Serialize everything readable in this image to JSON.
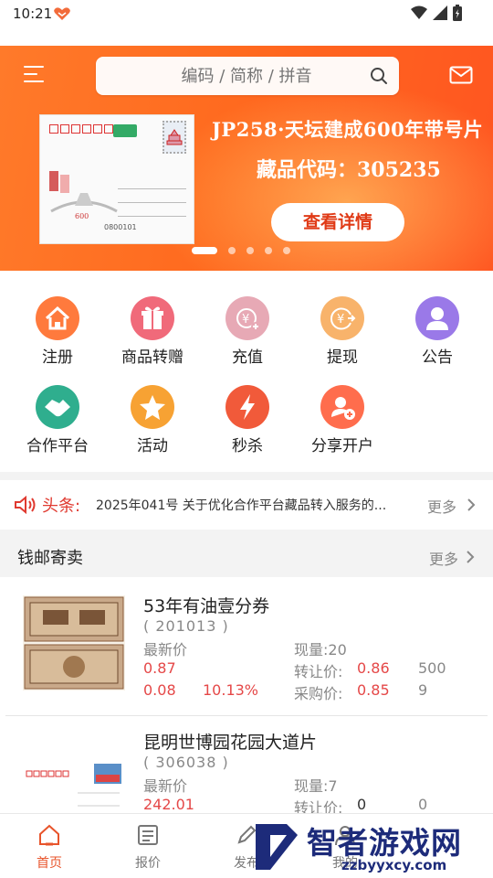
{
  "status_bar": {
    "time": "10:21"
  },
  "header": {
    "search_placeholder": "编码 / 简称 / 拼音"
  },
  "banner": {
    "title": "JP258·天坛建成600年带号片",
    "code": "藏品代码：305235",
    "button_label": "查看详情",
    "slide_count": 5,
    "active_slide": 1,
    "card_serial": "0800101"
  },
  "quick_actions": [
    {
      "label": "注册",
      "icon": "house-icon",
      "color": "#ff7a3d"
    },
    {
      "label": "商品转赠",
      "icon": "gift-icon",
      "color": "#f06a7a"
    },
    {
      "label": "充值",
      "icon": "yen-plus-icon",
      "color": "#e7a9b5"
    },
    {
      "label": "提现",
      "icon": "yen-out-icon",
      "color": "#f8b36b"
    },
    {
      "label": "公告",
      "icon": "person-icon",
      "color": "#9a79e8"
    },
    {
      "label": "合作平台",
      "icon": "handshake-icon",
      "color": "#2fae8e"
    },
    {
      "label": "活动",
      "icon": "star-icon",
      "color": "#f7a233"
    },
    {
      "label": "秒杀",
      "icon": "lightning-icon",
      "color": "#f15a3a"
    },
    {
      "label": "分享开户",
      "icon": "user-add-icon",
      "color": "#ff6d4d"
    }
  ],
  "news": {
    "tag": "头条:",
    "text": "2025年041号 关于优化合作平台藏品转入服务的...",
    "more": "更多"
  },
  "section": {
    "title": "钱邮寄卖",
    "more": "更多"
  },
  "products": [
    {
      "name": "53年有油壹分券",
      "code": "( 201013 )",
      "latest_label": "最新价",
      "latest_price": "0.87",
      "change": "0.08",
      "change_pct": "10.13%",
      "volume_label": "现量:",
      "volume": "20",
      "transfer_label": "转让价:",
      "transfer_price": "0.86",
      "transfer_qty": "500",
      "buy_label": "采购价:",
      "buy_price": "0.85",
      "buy_qty": "9"
    },
    {
      "name": "昆明世博园花园大道片",
      "code": "( 306038 )",
      "latest_label": "最新价",
      "latest_price": "242.01",
      "volume_label": "现量:",
      "volume": "7",
      "transfer_label": "转让价:",
      "transfer_price": "0",
      "transfer_qty": "0"
    }
  ],
  "bottom_nav": [
    {
      "label": "首页",
      "icon": "home-icon",
      "active": true
    },
    {
      "label": "报价",
      "icon": "list-icon",
      "active": false
    },
    {
      "label": "发布",
      "icon": "pen-icon",
      "active": false
    },
    {
      "label": "我的",
      "icon": "user-icon",
      "active": false
    }
  ],
  "watermark": {
    "text": "智者游戏网",
    "sub": "zzbyyxcy.com"
  },
  "colors": {
    "accent": "#ff6a1f",
    "price_red": "#e54848",
    "nav_active": "#e8542b"
  }
}
